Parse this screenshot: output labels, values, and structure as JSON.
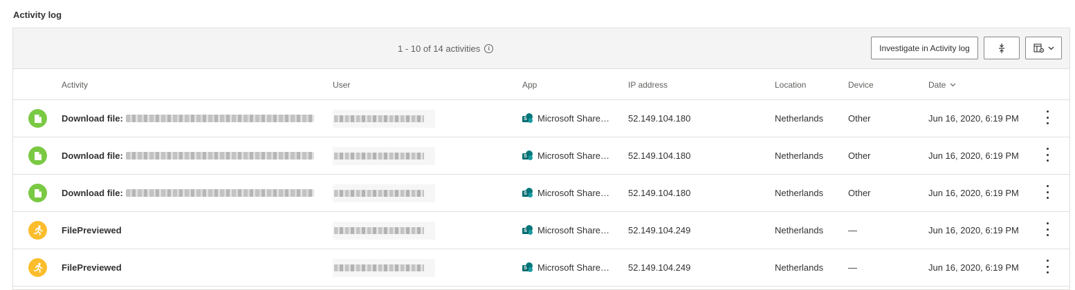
{
  "page": {
    "title": "Activity log"
  },
  "toolbar": {
    "count_text": "1 - 10 of 14 activities",
    "info_icon": "info-icon",
    "investigate_label": "Investigate in Activity log",
    "density_icon": "row-density-icon",
    "columns_icon": "column-settings-icon",
    "columns_chevron": "chevron-down-icon"
  },
  "columns": {
    "activity": "Activity",
    "user": "User",
    "app": "App",
    "ip": "IP address",
    "location": "Location",
    "device": "Device",
    "date": "Date"
  },
  "colors": {
    "download": "#7ac943",
    "preview": "#fbbd2b",
    "sharepoint": "#03787c"
  },
  "rows": [
    {
      "icon": "file-icon",
      "activity": "Download file:",
      "app": "Microsoft Share…",
      "ip": "52.149.104.180",
      "location": "Netherlands",
      "device": "Other",
      "date": "Jun 16, 2020, 6:19 PM"
    },
    {
      "icon": "file-icon",
      "activity": "Download file:",
      "app": "Microsoft Share…",
      "ip": "52.149.104.180",
      "location": "Netherlands",
      "device": "Other",
      "date": "Jun 16, 2020, 6:19 PM"
    },
    {
      "icon": "file-icon",
      "activity": "Download file:",
      "app": "Microsoft Share…",
      "ip": "52.149.104.180",
      "location": "Netherlands",
      "device": "Other",
      "date": "Jun 16, 2020, 6:19 PM"
    },
    {
      "icon": "run-icon",
      "activity": "FilePreviewed",
      "app": "Microsoft Share…",
      "ip": "52.149.104.249",
      "location": "Netherlands",
      "device": "—",
      "date": "Jun 16, 2020, 6:19 PM"
    },
    {
      "icon": "run-icon",
      "activity": "FilePreviewed",
      "app": "Microsoft Share…",
      "ip": "52.149.104.249",
      "location": "Netherlands",
      "device": "—",
      "date": "Jun 16, 2020, 6:19 PM"
    }
  ]
}
